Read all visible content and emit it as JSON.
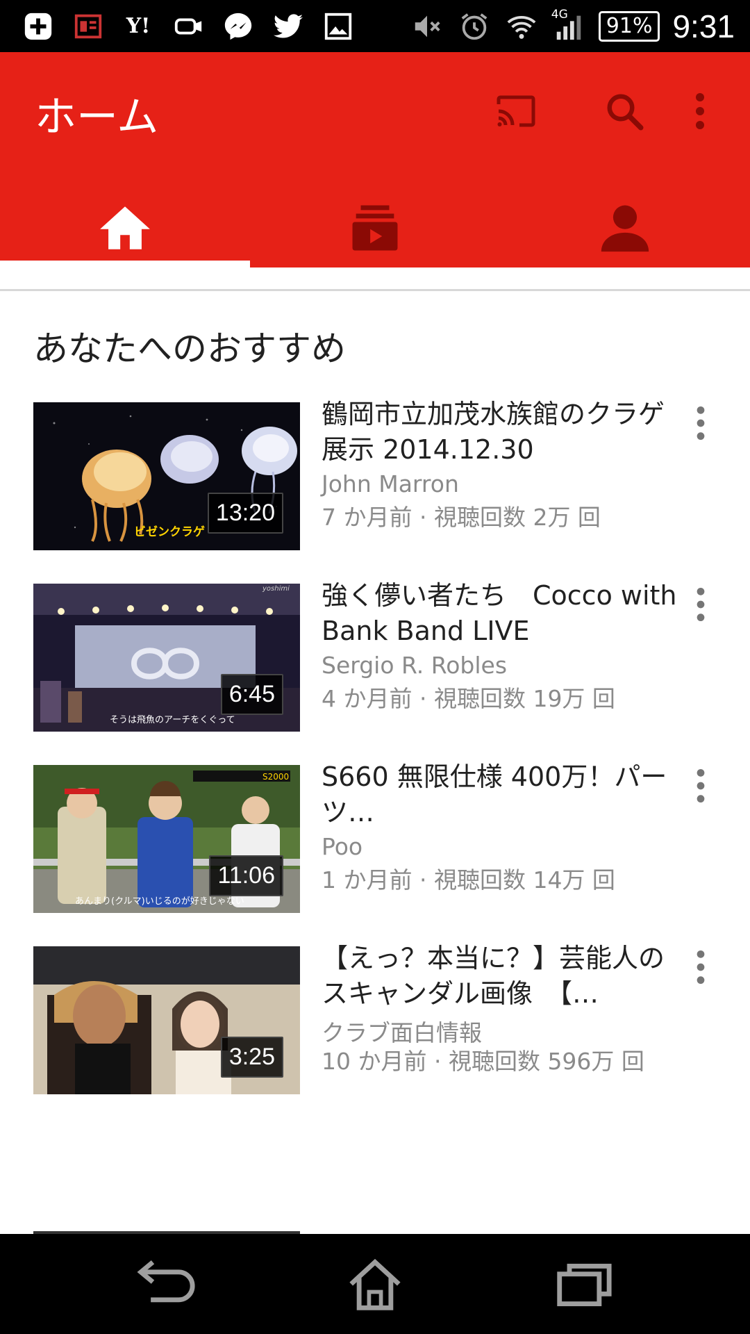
{
  "status_bar": {
    "icons_left": [
      "add-icon",
      "news-icon",
      "yahoo-icon",
      "speaker-icon",
      "messenger-icon",
      "twitter-icon",
      "gallery-icon"
    ],
    "yahoo_label": "Y!",
    "icons_right": [
      "mute-icon",
      "alarm-icon",
      "wifi-icon",
      "signal-icon"
    ],
    "network": "4G",
    "battery": "91%",
    "time": "9:31"
  },
  "app_bar": {
    "title": "ホーム",
    "actions": [
      "cast-icon",
      "search-icon",
      "more-vert-icon"
    ],
    "color": "#e62117"
  },
  "tabs": [
    {
      "icon": "home-icon",
      "selected": true
    },
    {
      "icon": "subscriptions-icon",
      "selected": false
    },
    {
      "icon": "account-icon",
      "selected": false
    }
  ],
  "section": {
    "title": "あなたへのおすすめ"
  },
  "videos": [
    {
      "title": "鶴岡市立加茂水族館のクラゲ展示 2014.12.30",
      "channel": "John Marron",
      "meta": "7 か月前 · 視聴回数 2万 回",
      "duration": "13:20",
      "thumb_caption": "ビゼンクラゲ"
    },
    {
      "title": "強く儚い者たち　Cocco with Bank Band LIVE",
      "channel": "Sergio R. Robles",
      "meta": "4 か月前 · 視聴回数 19万 回",
      "duration": "6:45",
      "thumb_caption": "そうは飛魚のアーチをくぐって",
      "thumb_watermark": "yoshimi"
    },
    {
      "title": "S660 無限仕様 400万！パーツ…",
      "channel": "Poo",
      "meta": "1 か月前 · 視聴回数 14万 回",
      "duration": "11:06",
      "thumb_caption": "あんまり(クルマ)いじるのが好きじゃない",
      "thumb_tag": "S2000"
    },
    {
      "title": "【えっ？本当に？】芸能人のスキャンダル画像　【…",
      "channel": "クラブ面白情報",
      "meta": "10 か月前 · 視聴回数 596万 回",
      "duration": "3:25"
    }
  ],
  "nav_bar": [
    "back-icon",
    "home-nav-icon",
    "recents-icon"
  ]
}
